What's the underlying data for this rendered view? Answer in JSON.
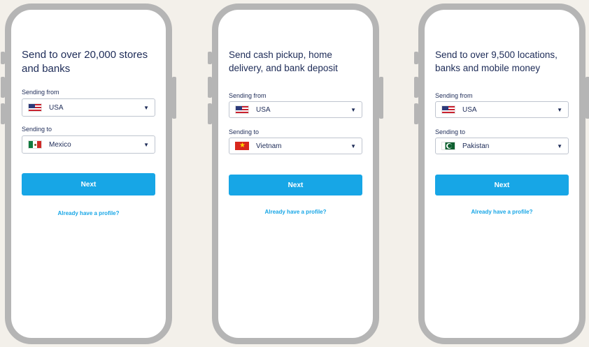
{
  "phones": [
    {
      "title": "Send to over 20,000 stores and banks",
      "sending_from_label": "Sending from",
      "sending_from_value": "USA",
      "sending_to_label": "Sending to",
      "sending_to_value": "Mexico",
      "next_label": "Next",
      "profile_link": "Already have a profile?"
    },
    {
      "title": "Send cash pickup, home delivery, and bank deposit",
      "sending_from_label": "Sending from",
      "sending_from_value": "USA",
      "sending_to_label": "Sending to",
      "sending_to_value": "Vietnam",
      "next_label": "Next",
      "profile_link": "Already have a profile?"
    },
    {
      "title": "Send to over 9,500 locations, banks and mobile money",
      "sending_from_label": "Sending from",
      "sending_from_value": "USA",
      "sending_to_label": "Sending to",
      "sending_to_value": "Pakistan",
      "next_label": "Next",
      "profile_link": "Already have a profile?"
    }
  ],
  "icons": {
    "dropdown": "caret-down-icon",
    "flags": [
      "usa-flag-icon",
      "mexico-flag-icon",
      "vietnam-flag-icon",
      "pakistan-flag-icon"
    ]
  },
  "colors": {
    "accent": "#17a6e6",
    "title_text": "#1d2b57",
    "phone_frame": "#b5b5b5",
    "background": "#f3f0ea"
  }
}
